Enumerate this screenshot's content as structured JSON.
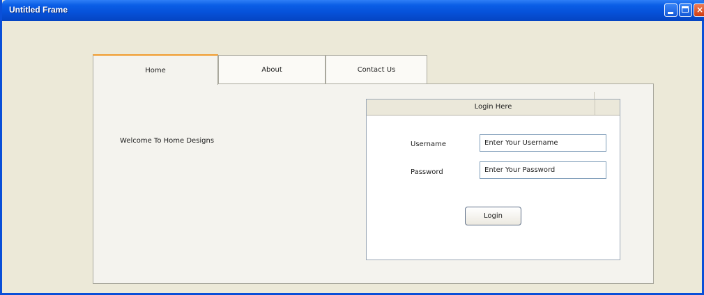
{
  "window": {
    "title": "Untitled Frame",
    "close_glyph": "×"
  },
  "tabs": [
    {
      "label": "Home",
      "selected": true
    },
    {
      "label": "About",
      "selected": false
    },
    {
      "label": "Contact Us",
      "selected": false
    }
  ],
  "home": {
    "welcome_text": "Welcome To Home Designs"
  },
  "login": {
    "header": "Login Here",
    "username_label": "Username",
    "username_placeholder": "Enter Your Username",
    "password_label": "Password",
    "password_placeholder": "Enter Your Password",
    "button_label": "Login"
  },
  "colors": {
    "titlebar": "#0651d9",
    "selected_tab_accent": "#f19b2c",
    "window_background": "#ece9d8"
  },
  "icons": {
    "minimize": "minimize-icon",
    "maximize": "maximize-icon",
    "close": "close-icon"
  }
}
